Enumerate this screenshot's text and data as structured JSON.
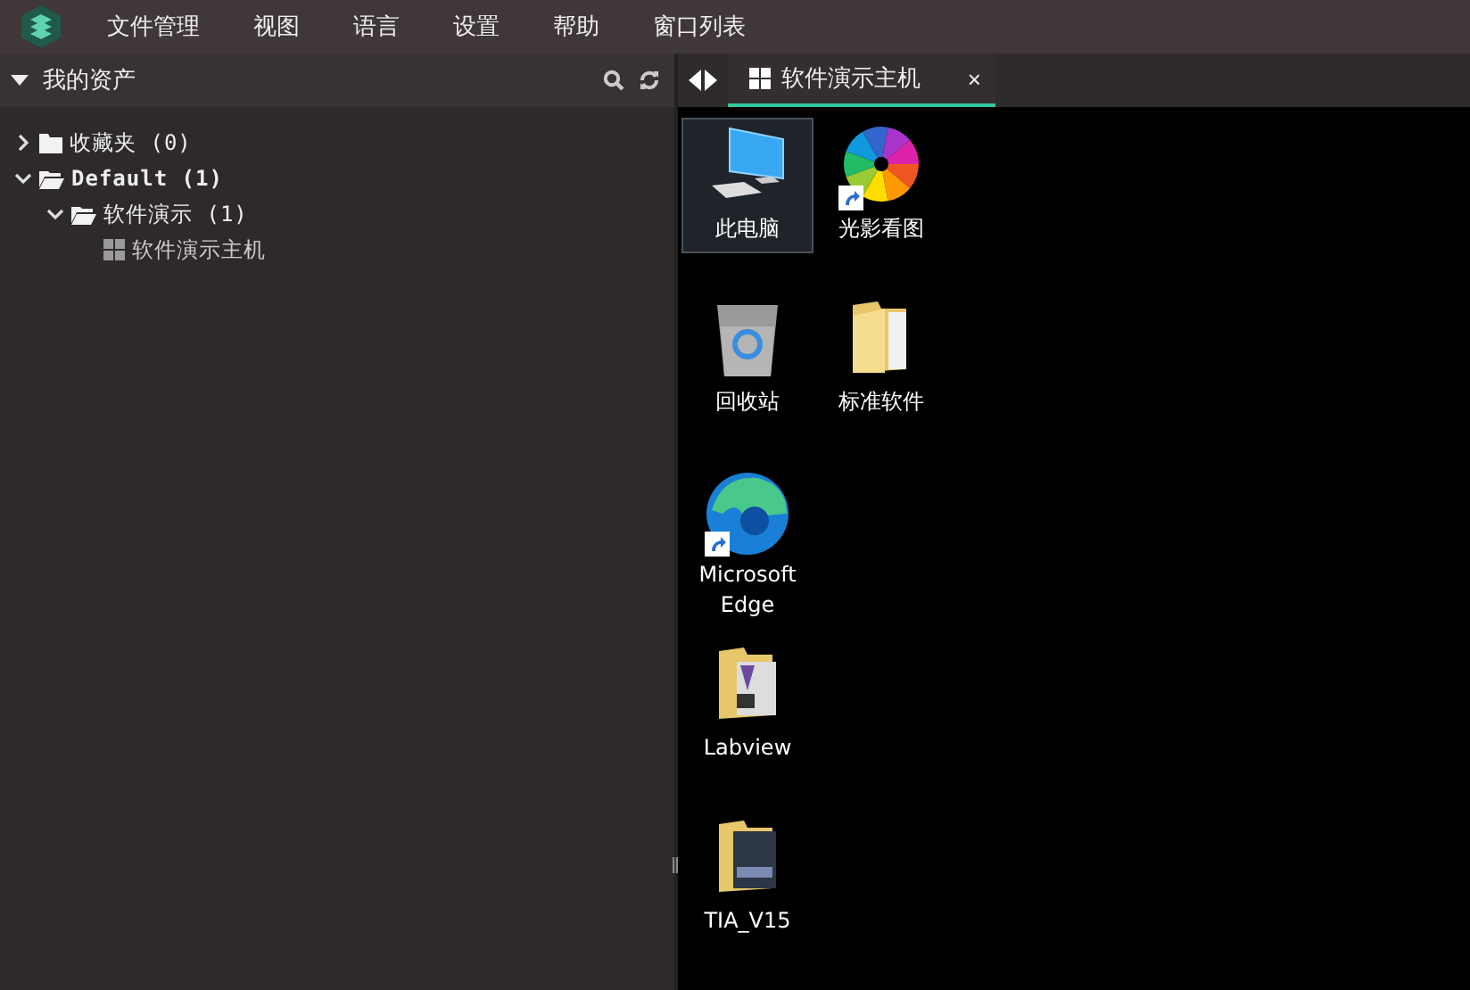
{
  "menu": [
    "文件管理",
    "视图",
    "语言",
    "设置",
    "帮助",
    "窗口列表"
  ],
  "sidebar": {
    "title": "我的资产",
    "expanded": true,
    "tree": [
      {
        "label": "收藏夹 (0)",
        "kind": "folder",
        "expanded": false,
        "bold": false
      },
      {
        "label": "Default (1)",
        "kind": "folder",
        "expanded": true,
        "bold": true,
        "children": [
          {
            "label": "软件演示 (1)",
            "kind": "folder",
            "expanded": true,
            "bold": false,
            "children": [
              {
                "label": "软件演示主机",
                "kind": "host",
                "bold": false
              }
            ]
          }
        ]
      }
    ]
  },
  "tabs": [
    {
      "label": "软件演示主机",
      "selected": true,
      "close": "×"
    }
  ],
  "desktop_icons": [
    {
      "label": "此电脑",
      "kind": "computer",
      "selected": true,
      "shortcut": false
    },
    {
      "label": "回收站",
      "kind": "bin",
      "selected": false,
      "shortcut": false
    },
    {
      "label": "Microsoft Edge",
      "kind": "edge",
      "selected": false,
      "shortcut": true
    },
    {
      "label": "Labview",
      "kind": "folder-doc",
      "selected": false,
      "shortcut": false
    },
    {
      "label": "TIA_V15",
      "kind": "folder-dark",
      "selected": false,
      "shortcut": false
    },
    {
      "label": "光影看图",
      "kind": "color-wheel",
      "selected": false,
      "shortcut": true
    },
    {
      "label": "标准软件",
      "kind": "folder",
      "selected": false,
      "shortcut": false
    }
  ]
}
